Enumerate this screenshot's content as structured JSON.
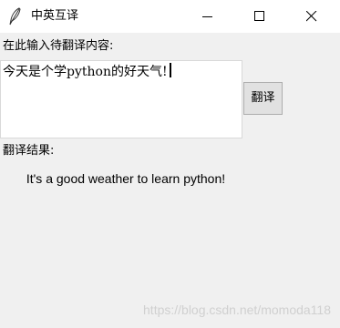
{
  "window": {
    "title": "中英互译",
    "icon": "feather-icon",
    "controls": [
      "minimize-icon",
      "maximize-icon",
      "close-icon"
    ]
  },
  "input": {
    "label": "在此输入待翻译内容:",
    "value": "今天是个学python的好天气!"
  },
  "translate_button": {
    "label": "翻译"
  },
  "result": {
    "label": "翻译结果:",
    "text": "It's a good weather to learn python!"
  },
  "watermark": "https://blog.csdn.net/momoda118"
}
